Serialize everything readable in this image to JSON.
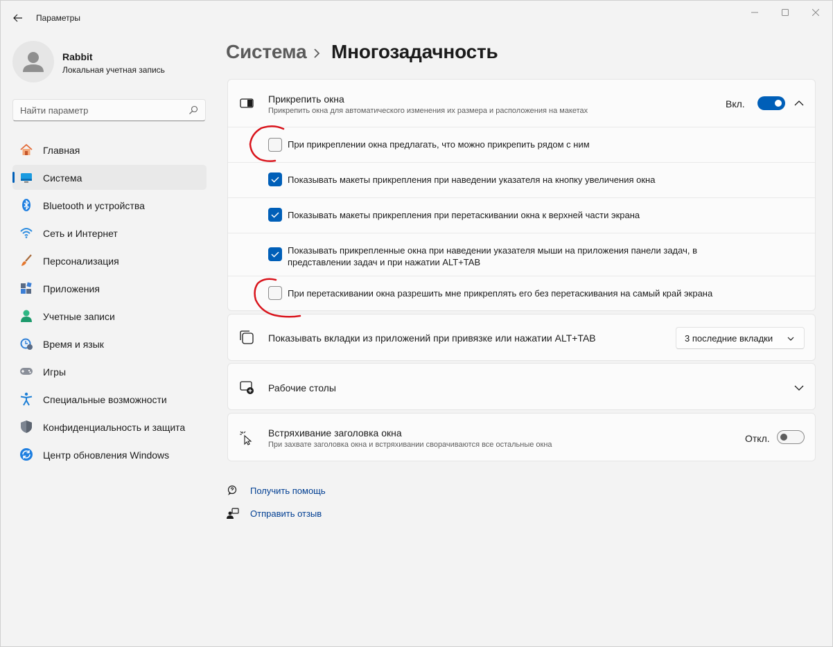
{
  "window": {
    "title": "Параметры"
  },
  "profile": {
    "name": "Rabbit",
    "account_type": "Локальная учетная запись"
  },
  "search": {
    "placeholder": "Найти параметр"
  },
  "sidebar": {
    "items": [
      {
        "label": "Главная",
        "icon": "home-icon",
        "active": false
      },
      {
        "label": "Система",
        "icon": "system-icon",
        "active": true
      },
      {
        "label": "Bluetooth и устройства",
        "icon": "bluetooth-icon",
        "active": false
      },
      {
        "label": "Сеть и Интернет",
        "icon": "wifi-icon",
        "active": false
      },
      {
        "label": "Персонализация",
        "icon": "brush-icon",
        "active": false
      },
      {
        "label": "Приложения",
        "icon": "apps-icon",
        "active": false
      },
      {
        "label": "Учетные записи",
        "icon": "accounts-icon",
        "active": false
      },
      {
        "label": "Время и язык",
        "icon": "time-language-icon",
        "active": false
      },
      {
        "label": "Игры",
        "icon": "gamepad-icon",
        "active": false
      },
      {
        "label": "Специальные возможности",
        "icon": "accessibility-icon",
        "active": false
      },
      {
        "label": "Конфиденциальность и защита",
        "icon": "shield-icon",
        "active": false
      },
      {
        "label": "Центр обновления Windows",
        "icon": "update-icon",
        "active": false
      }
    ]
  },
  "breadcrumb": {
    "parent": "Система",
    "current": "Многозадачность"
  },
  "snap": {
    "title": "Прикрепить окна",
    "description": "Прикрепить окна для автоматического изменения их размера и расположения на макетах",
    "state_label": "Вкл.",
    "enabled": true,
    "options": [
      {
        "label": "При прикреплении окна предлагать, что можно прикрепить рядом с ним",
        "checked": false
      },
      {
        "label": "Показывать макеты прикрепления при наведении указателя на кнопку увеличения окна",
        "checked": true
      },
      {
        "label": "Показывать макеты прикрепления при перетаскивании окна к верхней части экрана",
        "checked": true
      },
      {
        "label_line1": "Показывать прикрепленные окна при наведении указателя мыши на приложения панели задач, в",
        "label_line2": "представлении задач и при нажатии ALT+TAB",
        "checked": true
      },
      {
        "label": "При перетаскивании окна разрешить мне прикреплять его без перетаскивания на самый край экрана",
        "checked": false
      }
    ]
  },
  "tabs_setting": {
    "title": "Показывать вкладки из приложений при привязке или нажатии ALT+TAB",
    "selected": "3 последние вкладки"
  },
  "desktops": {
    "title": "Рабочие столы"
  },
  "shake": {
    "title": "Встряхивание заголовка окна",
    "description": "При захвате заголовка окна и встряхивании сворачиваются все остальные окна",
    "state_label": "Откл.",
    "enabled": false
  },
  "links": {
    "help": "Получить помощь",
    "feedback": "Отправить отзыв"
  },
  "colors": {
    "accent": "#005fb8",
    "annotation": "#d9141c",
    "link": "#003e92"
  }
}
